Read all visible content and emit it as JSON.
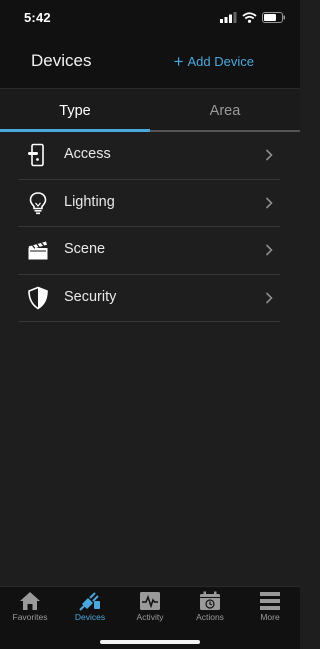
{
  "status_bar": {
    "time": "5:42"
  },
  "header": {
    "title": "Devices",
    "add_label": "Add Device",
    "add_icon": "plus-icon"
  },
  "tabs": [
    {
      "label": "Type",
      "selected": true
    },
    {
      "label": "Area",
      "selected": false
    }
  ],
  "list": {
    "items": [
      {
        "label": "Access",
        "icon": "door-lock-icon"
      },
      {
        "label": "Lighting",
        "icon": "lightbulb-icon"
      },
      {
        "label": "Scene",
        "icon": "clapperboard-icon"
      },
      {
        "label": "Security",
        "icon": "shield-icon"
      }
    ]
  },
  "tabbar": {
    "items": [
      {
        "label": "Favorites",
        "icon": "home-icon",
        "active": false
      },
      {
        "label": "Devices",
        "icon": "devices-plug-icon",
        "active": true
      },
      {
        "label": "Activity",
        "icon": "activity-icon",
        "active": false
      },
      {
        "label": "Actions",
        "icon": "calendar-clock-icon",
        "active": false
      },
      {
        "label": "More",
        "icon": "menu-icon",
        "active": false
      }
    ]
  },
  "colors": {
    "accent": "#4ba8dc",
    "background": "#1e1e1e",
    "bar": "#111111"
  }
}
